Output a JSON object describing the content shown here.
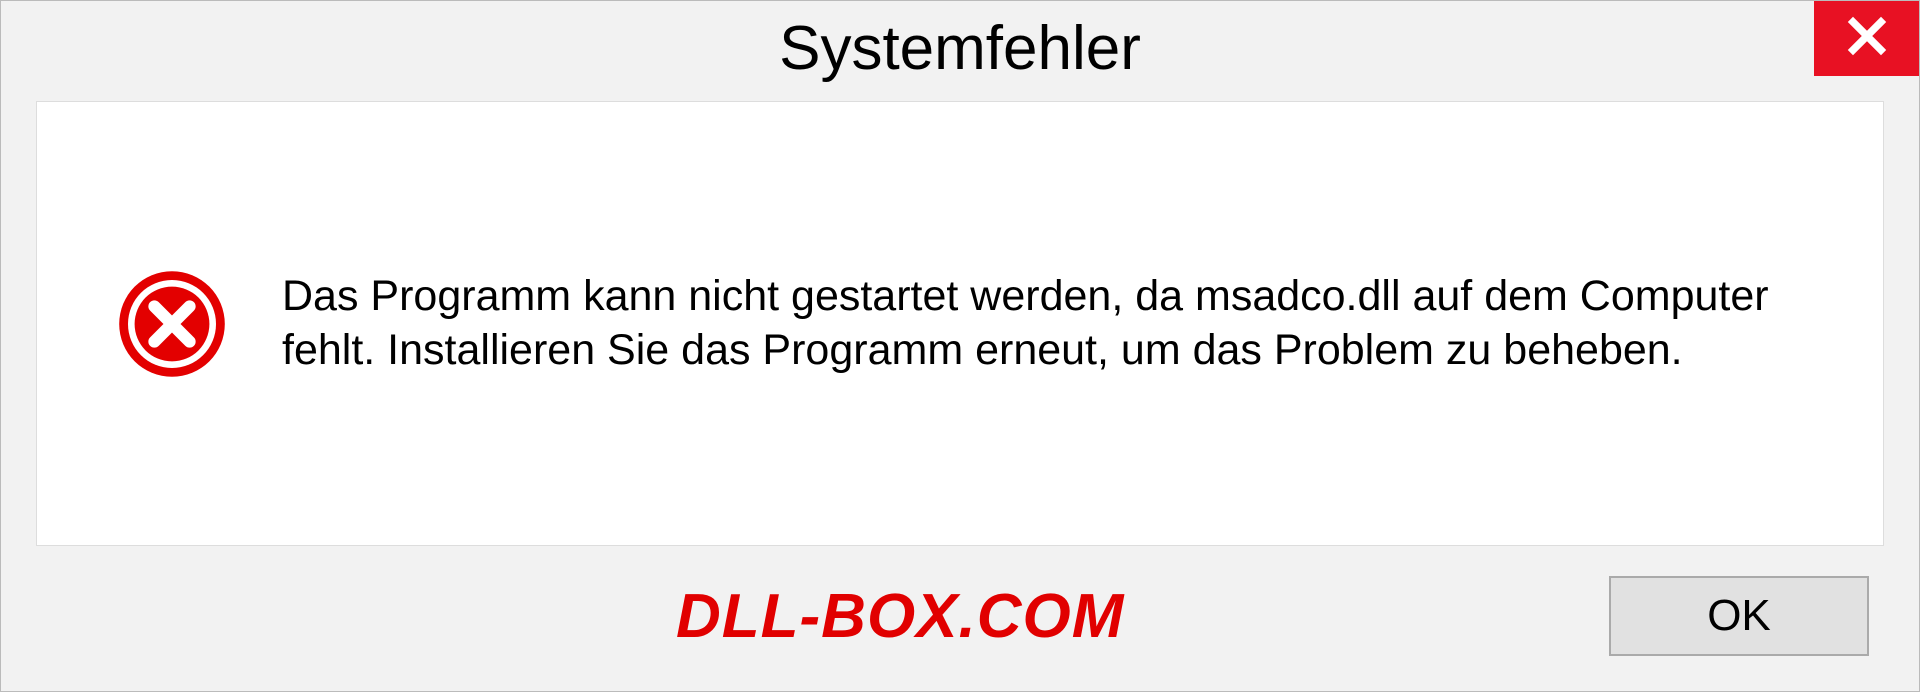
{
  "dialog": {
    "title": "Systemfehler",
    "message": "Das Programm kann nicht gestartet werden, da msadco.dll auf dem Computer fehlt. Installieren Sie das Programm erneut, um das Problem zu beheben.",
    "ok_label": "OK",
    "watermark": "DLL-BOX.COM"
  }
}
